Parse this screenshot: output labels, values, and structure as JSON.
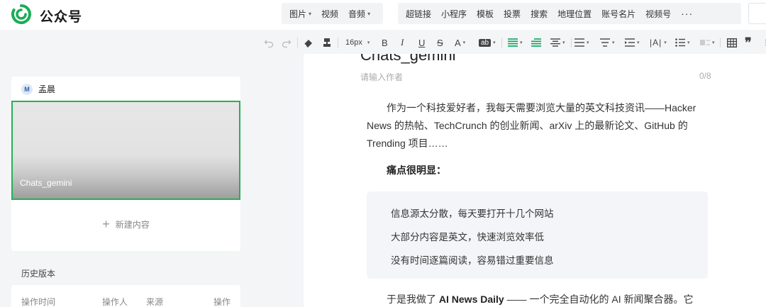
{
  "brand": {
    "name": "公众号"
  },
  "menu_left": [
    {
      "label": "图片",
      "dropdown": true
    },
    {
      "label": "视频",
      "dropdown": false
    },
    {
      "label": "音频",
      "dropdown": true
    }
  ],
  "menu_right": [
    {
      "label": "超链接"
    },
    {
      "label": "小程序"
    },
    {
      "label": "模板"
    },
    {
      "label": "投票"
    },
    {
      "label": "搜索"
    },
    {
      "label": "地理位置"
    },
    {
      "label": "账号名片"
    },
    {
      "label": "视频号"
    }
  ],
  "more_label": "···",
  "toolbar": {
    "font_size": "16px",
    "bold": "B",
    "italic": "I",
    "underline": "U",
    "strike": "S",
    "font_color": "A",
    "bg_label": "ab"
  },
  "article": {
    "author_name": "孟晨",
    "avatar_letter": "M",
    "cover_title": "Chats_gemini",
    "new_content": "新建内容"
  },
  "history": {
    "title": "历史版本",
    "columns": [
      "操作时间",
      "操作人",
      "来源",
      "操作"
    ]
  },
  "editor": {
    "title": "Chats_gemini",
    "author_placeholder": "请输入作者",
    "author_counter": "0/8",
    "intro": "作为一个科技爱好者，我每天需要浏览大量的英文科技资讯——Hacker News 的热帖、TechCrunch 的创业新闻、arXiv 上的最新论文、GitHub 的 Trending 项目……",
    "pain_title": "痛点很明显：",
    "pain_points": [
      "信息源太分散，每天要打开十几个网站",
      "大部分内容是英文，快速浏览效率低",
      "没有时间逐篇阅读，容易错过重要信息"
    ],
    "closing_prefix": "于是我做了 ",
    "closing_bold": "AI News Daily",
    "closing_suffix": " —— 一个完全自动化的 AI 新闻聚合器。它"
  },
  "colors": {
    "accent_green": "#22b356",
    "toolbar_green": "#07a35a"
  }
}
